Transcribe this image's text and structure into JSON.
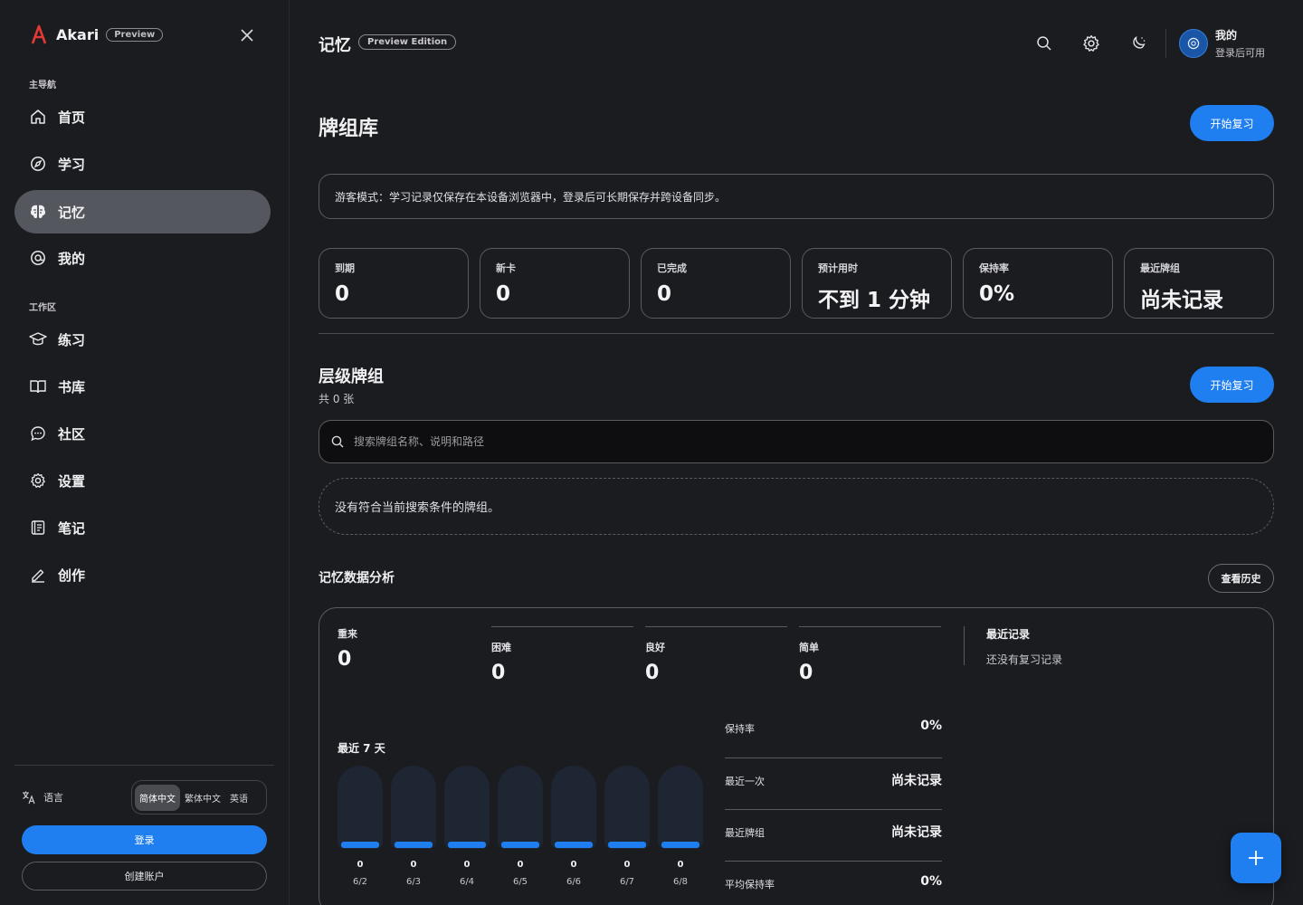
{
  "brand": {
    "name": "Akari",
    "badge": "Preview"
  },
  "sidebar": {
    "section_main": "主导航",
    "section_workspace": "工作区",
    "main_items": [
      {
        "label": "首页",
        "icon": "home-icon"
      },
      {
        "label": "学习",
        "icon": "compass-icon"
      },
      {
        "label": "记忆",
        "icon": "brain-icon",
        "active": true
      },
      {
        "label": "我的",
        "icon": "user-circle-icon"
      }
    ],
    "work_items": [
      {
        "label": "练习",
        "icon": "graduation-cap-icon"
      },
      {
        "label": "书库",
        "icon": "book-open-icon"
      },
      {
        "label": "社区",
        "icon": "chat-bubble-icon"
      },
      {
        "label": "设置",
        "icon": "gear-icon"
      },
      {
        "label": "笔记",
        "icon": "notebook-icon"
      },
      {
        "label": "创作",
        "icon": "pen-icon"
      }
    ],
    "language_label": "语言",
    "languages": [
      "简体中文",
      "繁体中文",
      "英语"
    ],
    "login": "登录",
    "create_account": "创建账户"
  },
  "topbar": {
    "title": "记忆",
    "badge": "Preview Edition",
    "user_name": "我的",
    "user_sub": "登录后可用"
  },
  "page": {
    "title": "牌组库",
    "start_review": "开始复习",
    "notice": "游客模式：学习记录仅保存在本设备浏览器中，登录后可长期保存并跨设备同步。",
    "stats": [
      {
        "label": "到期",
        "value": "0"
      },
      {
        "label": "新卡",
        "value": "0"
      },
      {
        "label": "已完成",
        "value": "0"
      },
      {
        "label": "预计用时",
        "value": "不到 1 分钟"
      },
      {
        "label": "保持率",
        "value": "0%"
      },
      {
        "label": "最近牌组",
        "value": "尚未记录"
      }
    ]
  },
  "decks": {
    "title": "层级牌组",
    "count": "共 0 张",
    "start_review": "开始复习",
    "search_placeholder": "搜索牌组名称、说明和路径",
    "empty": "没有符合当前搜索条件的牌组。"
  },
  "analysis": {
    "title": "记忆数据分析",
    "history_button": "查看历史",
    "ratings": [
      {
        "label": "重来",
        "value": "0"
      },
      {
        "label": "困难",
        "value": "0"
      },
      {
        "label": "良好",
        "value": "0"
      },
      {
        "label": "简单",
        "value": "0"
      }
    ],
    "recent_title": "最近记录",
    "recent_empty": "还没有复习记录",
    "days_title": "最近 7 天",
    "days": [
      {
        "date": "6/2",
        "count": "0"
      },
      {
        "date": "6/3",
        "count": "0"
      },
      {
        "date": "6/4",
        "count": "0"
      },
      {
        "date": "6/5",
        "count": "0"
      },
      {
        "date": "6/6",
        "count": "0"
      },
      {
        "date": "6/7",
        "count": "0"
      },
      {
        "date": "6/8",
        "count": "0"
      }
    ],
    "metrics": [
      {
        "label": "保持率",
        "value": "0%"
      },
      {
        "label": "最近一次",
        "value": "尚未记录"
      },
      {
        "label": "最近牌组",
        "value": "尚未记录"
      },
      {
        "label": "平均保持率",
        "value": "0%"
      }
    ]
  },
  "colors": {
    "accent": "#1f7ff0",
    "brand_red": "#e53935",
    "background": "#1b1c20"
  }
}
